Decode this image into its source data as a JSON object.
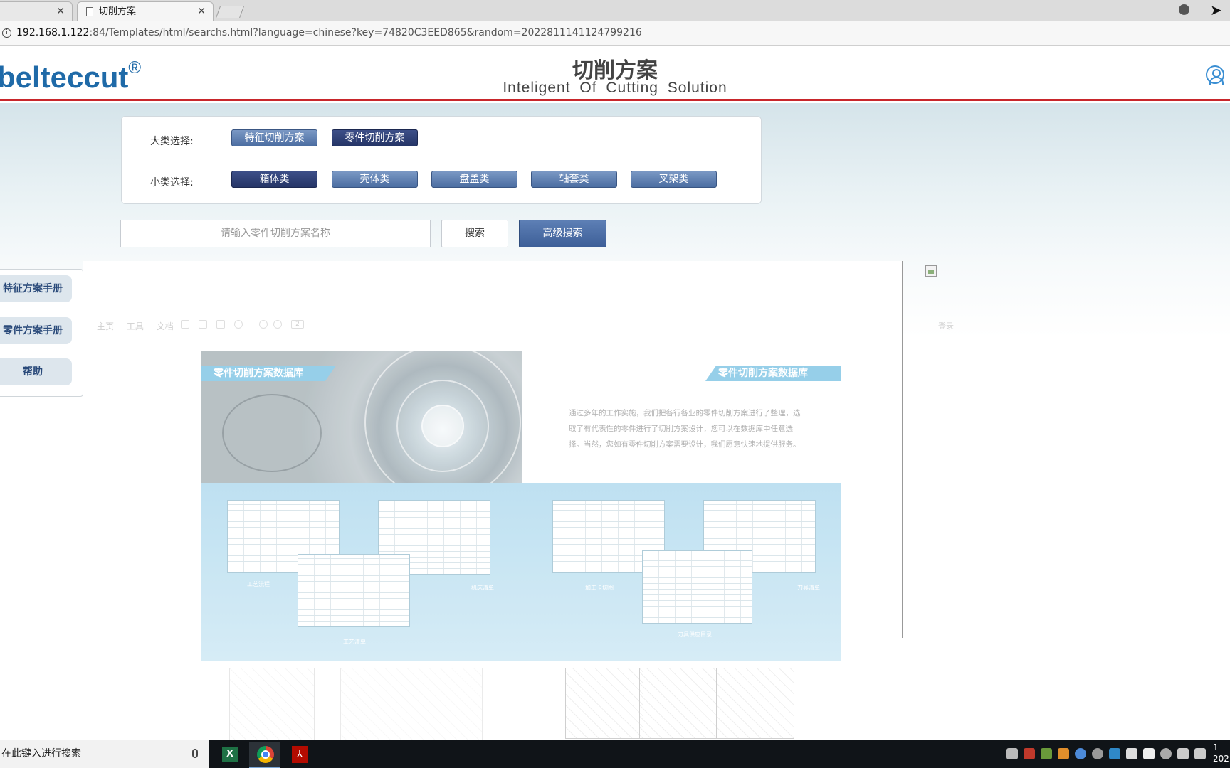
{
  "browser": {
    "tabs": [
      {
        "label": ""
      },
      {
        "label": "切削方案"
      }
    ],
    "url_host": "192.168.1.122",
    "url_rest": ":84/Templates/html/searchs.html?language=chinese?key=74820C3EED865&random=2022811141124799216"
  },
  "header": {
    "logo": "beltecc ut",
    "logo_text": "oeltec cut",
    "logo_display": "eltec cut",
    "title": "切削方案",
    "subtitle": "Inteligent  Of  Cutting Solution",
    "registered": "®"
  },
  "filters": {
    "major_label": "大类选择:",
    "major_options": [
      "特征切削方案",
      "零件切削方案"
    ],
    "minor_label": "小类选择:",
    "minor_options": [
      "箱体类",
      "壳体类",
      "盘盖类",
      "轴套类",
      "叉架类"
    ]
  },
  "search": {
    "placeholder": "请输入零件切削方案名称",
    "search_label": "搜索",
    "advanced_label": "高级搜索"
  },
  "sidebar": {
    "items": [
      {
        "label": "特征方案手册"
      },
      {
        "label": "零件方案手册"
      },
      {
        "label": "帮助"
      }
    ]
  },
  "pdf": {
    "tabs": [
      "主页",
      "工具",
      "文档"
    ],
    "page_box": "2",
    "right_label": "登录",
    "banner_left": "零件切削方案数据库",
    "banner_right": "零件切削方案数据库",
    "paragraph": "通过多年的工作实施，我们把各行各业的零件切削方案进行了整理，选取了有代表性的零件进行了切削方案设计，您可以在数据库中任意选择。当然，您如有零件切削方案需要设计，我们愿意快速地提供服务。",
    "sheet_labels": [
      "工艺流程",
      "机床清单",
      "工艺清单",
      "加工卡切图",
      "刀具清单",
      "刀具供应目录"
    ]
  },
  "taskbar": {
    "search_text": "在此键入进行搜索",
    "clock_time": "1",
    "clock_date": "202"
  }
}
